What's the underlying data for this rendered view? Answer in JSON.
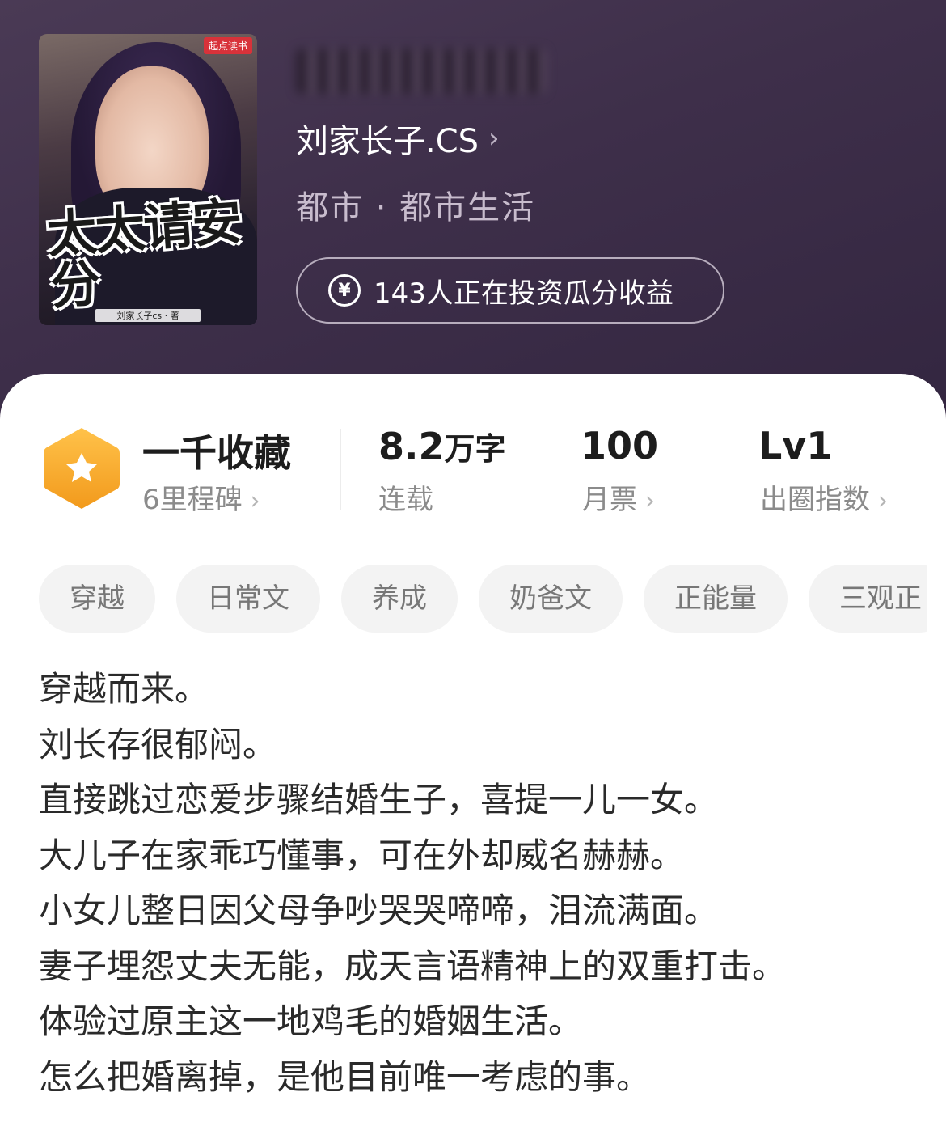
{
  "book": {
    "cover": {
      "title_art": "太太请安分",
      "badge": "起点读书",
      "author_credit": "刘家长子cs · 著"
    },
    "author": "刘家长子.CS",
    "genre": "都市 · 都市生活",
    "invest_text": "143人正在投资瓜分收益"
  },
  "stats": {
    "milestone": {
      "title": "一千收藏",
      "sub": "6里程碑"
    },
    "words": {
      "value": "8.2",
      "unit": "万字",
      "sub": "连载"
    },
    "monthly_votes": {
      "value": "100",
      "sub": "月票"
    },
    "breakout": {
      "value": "Lv1",
      "sub": "出圈指数"
    }
  },
  "tags": [
    "穿越",
    "日常文",
    "养成",
    "奶爸文",
    "正能量",
    "三观正"
  ],
  "synopsis": [
    "穿越而来。",
    "刘长存很郁闷。",
    "直接跳过恋爱步骤结婚生子，喜提一儿一女。",
    "大儿子在家乖巧懂事，可在外却威名赫赫。",
    "小女儿整日因父母争吵哭哭啼啼，泪流满面。",
    "妻子埋怨丈夫无能，成天言语精神上的双重打击。",
    "体验过原主这一地鸡毛的婚姻生活。",
    "怎么把婚离掉，是他目前唯一考虑的事。"
  ],
  "icons": {
    "milestone": "star-hexagon-icon",
    "chevron": "chevron-right-icon",
    "invest": "yen-coin-icon"
  },
  "colors": {
    "hero_bg": "#3e2f4a",
    "milestone_orange": "#f5a623"
  }
}
